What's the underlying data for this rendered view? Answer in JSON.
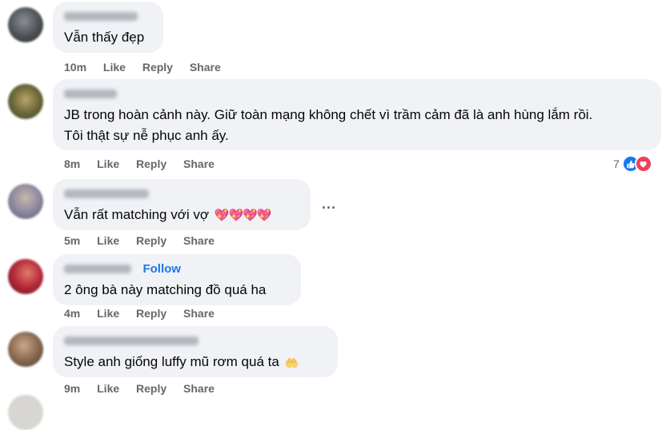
{
  "comments": [
    {
      "author": "",
      "text": "Vẫn thấy đẹp",
      "time": "10m",
      "like": "Like",
      "reply": "Reply",
      "share": "Share"
    },
    {
      "author": "",
      "text_line1": "JB trong hoàn cảnh này. Giữ toàn mạng không chết vì trầm cảm đã là anh hùng lắm rồi.",
      "text_line2": "Tôi thật sự nễ phục anh ấy.",
      "time": "8m",
      "like": "Like",
      "reply": "Reply",
      "share": "Share",
      "reaction_count": "7",
      "reaction_icons": [
        "like-icon",
        "love-icon"
      ]
    },
    {
      "author": "",
      "text": "Vẫn rất matching với vợ",
      "emoji": "💖💖💖💖",
      "time": "5m",
      "like": "Like",
      "reply": "Reply",
      "share": "Share",
      "more": "..."
    },
    {
      "author": "",
      "follow": "Follow",
      "text": "2 ông bà này matching đồ quá ha",
      "time": "4m",
      "like": "Like",
      "reply": "Reply",
      "share": "Share"
    },
    {
      "author": "",
      "text": "Style anh giống luffy mũ rơm quá ta",
      "emoji": "🤲",
      "time": "9m",
      "like": "Like",
      "reply": "Reply",
      "share": "Share"
    }
  ],
  "colors": {
    "bubble": "#f0f2f5",
    "action_text": "#65676b",
    "follow": "#1877f2",
    "like_reaction": "#1877f2",
    "love_reaction": "#f33e58"
  }
}
